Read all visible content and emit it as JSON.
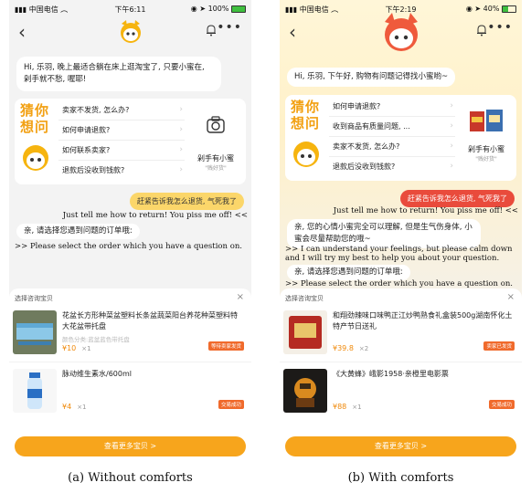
{
  "figure": {
    "caption_a": "(a)  Without comforts",
    "caption_b": "(b)  With comforts"
  },
  "phone_a": {
    "status": {
      "carrier": "中国电信",
      "time": "下午6:11",
      "battery": "100%",
      "battery_level": 1.0
    },
    "greeting": "Hi, 乐羽, 晚上最适合躺在床上逛淘宝了, 只要小蜜在, 剁手就不愁, 喔耶!",
    "guess_title": "猜你想问",
    "questions": [
      "卖家不发货, 怎么办?",
      "如何申请退款?",
      "如何联系卖家?",
      "退款后没收到钱款?"
    ],
    "promo_label": "剁手有小蜜",
    "promo_sub": "\"贱好货\"",
    "user_message": "赶紧告诉我怎么退货, 气死我了",
    "user_message_en": "Just tell me how to return! You piss me off! <<",
    "bot_reply": "亲, 请选择您遇到问题的订单哦:",
    "bot_reply_en": ">> Please select the order which you have a question on.",
    "sheet": {
      "title": "选择咨询宝贝",
      "close": "×",
      "products": [
        {
          "name": "花盆长方形种菜盆塑料长条盆蔬菜阳台养花种菜塑料特大花盆带托盘",
          "sub": "颜色分类:蓝盆蓝色带托盘",
          "price": "¥10",
          "qty": "×1",
          "tag": "等待卖家发货"
        },
        {
          "name": "脉动维生素水/600ml",
          "sub": "",
          "price": "¥4",
          "qty": "×1",
          "tag": "交易成功"
        }
      ],
      "more_button": "查看更多宝贝  >"
    }
  },
  "phone_b": {
    "status": {
      "carrier": "中国电信",
      "time": "下午2:19",
      "battery": "40%",
      "battery_level": 0.4
    },
    "greeting": "Hi, 乐羽, 下午好, 购物有问题记得找小蜜哟~",
    "guess_title": "猜你想问",
    "questions": [
      "如何申请退款?",
      "收到商品有质量问题, ...",
      "卖家不发货, 怎么办?",
      "退款后没收到钱款?"
    ],
    "promo_label": "剁手有小蜜",
    "promo_sub": "\"贱好货\"",
    "user_message": "赶紧告诉我怎么退货, 气死我了",
    "user_message_en": "Just tell me how to return! You piss me off! <<",
    "comfort": "亲, 您的心情小蜜完全可以理解, 但是生气伤身体, 小蜜会尽量帮助您的哦~",
    "comfort_en_1": ">> I can understand your feelings, but please calm down",
    "comfort_en_2": "and I will try my best to help you about your question.",
    "bot_reply": "亲, 请选择您遇到问题的订单哦:",
    "bot_reply_en": ">> Please select the order which you have a question on.",
    "sheet": {
      "title": "选择咨询宝贝",
      "close": "×",
      "products": [
        {
          "name": "和翔劲辣味口味鸭正江炒鸭熟食礼盒装500g湖南怀化土特产节日送礼",
          "sub": "",
          "price": "¥39.8",
          "qty": "×2",
          "tag": "卖家已发货"
        },
        {
          "name": "《大黄蜂》峨影1958·亲橙里电影票",
          "sub": "",
          "price": "¥88",
          "qty": "×1",
          "tag": "交易成功"
        }
      ],
      "more_button": "查看更多宝贝  >"
    }
  },
  "colors": {
    "accent": "#f7a51c",
    "user_bubble_a": "#fbd66a",
    "user_bubble_b": "#e94b3c",
    "tag": "#f06a2c"
  },
  "icons": [
    "back-icon",
    "bell-icon",
    "more-icon",
    "mascot-icon",
    "arrow-icon",
    "close-icon"
  ]
}
